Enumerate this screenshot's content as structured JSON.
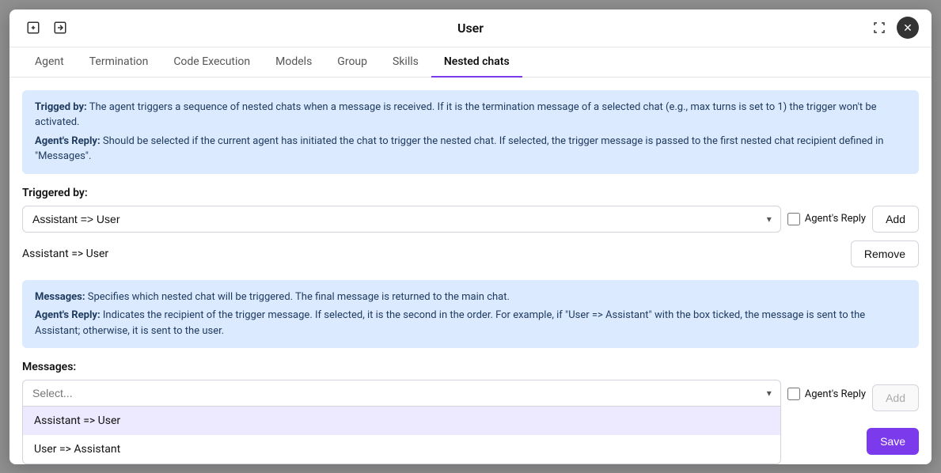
{
  "modal": {
    "title": "User",
    "expand_icon": "⛶",
    "close_icon": "✕",
    "export_icon": "📤",
    "import_icon": "📥"
  },
  "tabs": [
    {
      "id": "agent",
      "label": "Agent"
    },
    {
      "id": "termination",
      "label": "Termination"
    },
    {
      "id": "code-execution",
      "label": "Code Execution"
    },
    {
      "id": "models",
      "label": "Models"
    },
    {
      "id": "group",
      "label": "Group"
    },
    {
      "id": "skills",
      "label": "Skills"
    },
    {
      "id": "nested-chats",
      "label": "Nested chats"
    }
  ],
  "active_tab": "nested-chats",
  "info_box_1": {
    "triggered_by_label": "Trigged by:",
    "triggered_by_text": "The agent triggers a sequence of nested chats when a message is received. If it is the termination message of a selected chat (e.g., max turns is set to 1) the trigger won't be activated.",
    "agents_reply_label": "Agent's Reply:",
    "agents_reply_text": "Should be selected if the current agent has initiated the chat to trigger the nested chat. If selected, the trigger message is passed to the first nested chat recipient defined in \"Messages\"."
  },
  "triggered_by_section": {
    "label": "Triggered by:",
    "value": "Assistant => User",
    "agents_reply_label": "Agent's Reply",
    "add_label": "Add",
    "remove_label": "Remove",
    "existing_value": "Assistant => User"
  },
  "info_box_2": {
    "messages_label": "Messages:",
    "messages_text": "Specifies which nested chat will be triggered. The final message is returned to the main chat.",
    "agents_reply_label": "Agent's Reply:",
    "agents_reply_text": "Indicates the recipient of the trigger message. If selected, it is the second in the order. For example, if \"User => Assistant\" with the box ticked, the message is sent to the Assistant; otherwise, it is sent to the user."
  },
  "messages_section": {
    "label": "Messages:",
    "placeholder": "Select...",
    "agents_reply_label": "Agent's Reply",
    "add_label": "Add",
    "dropdown_options": [
      {
        "id": "assistant-user",
        "label": "Assistant => User",
        "highlighted": true
      },
      {
        "id": "user-assistant",
        "label": "User => Assistant",
        "highlighted": false
      }
    ]
  },
  "footer": {
    "save_label": "Save"
  }
}
